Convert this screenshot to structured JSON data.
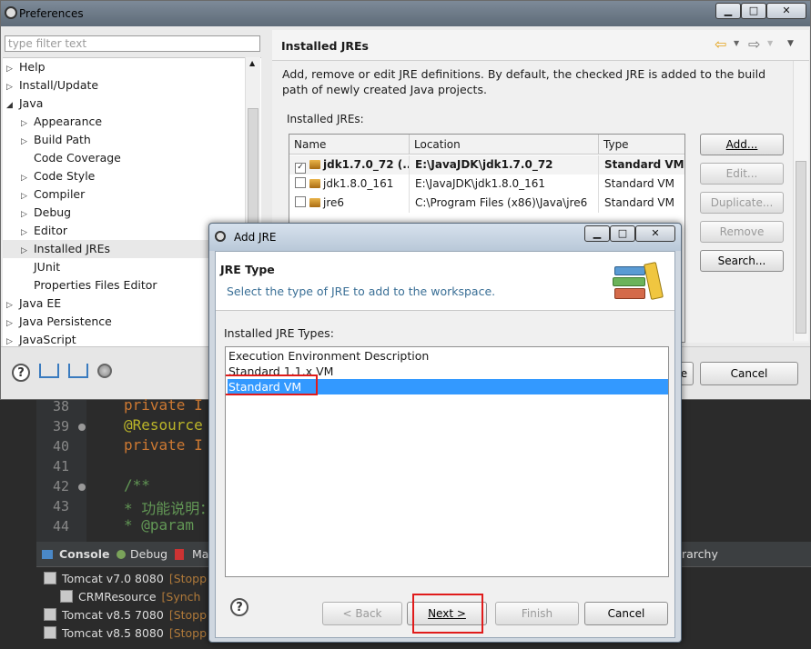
{
  "preferences": {
    "title": "Preferences",
    "filter_placeholder": "type filter text",
    "tree": [
      {
        "label": "Help",
        "expandable": true,
        "depth": 0
      },
      {
        "label": "Install/Update",
        "expandable": true,
        "depth": 0
      },
      {
        "label": "Java",
        "expandable": true,
        "expanded": true,
        "depth": 0
      },
      {
        "label": "Appearance",
        "expandable": true,
        "depth": 1
      },
      {
        "label": "Build Path",
        "expandable": true,
        "depth": 1
      },
      {
        "label": "Code Coverage",
        "expandable": false,
        "depth": 1
      },
      {
        "label": "Code Style",
        "expandable": true,
        "depth": 1
      },
      {
        "label": "Compiler",
        "expandable": true,
        "depth": 1
      },
      {
        "label": "Debug",
        "expandable": true,
        "depth": 1
      },
      {
        "label": "Editor",
        "expandable": true,
        "depth": 1
      },
      {
        "label": "Installed JREs",
        "expandable": true,
        "depth": 1,
        "selected": true
      },
      {
        "label": "JUnit",
        "expandable": false,
        "depth": 1
      },
      {
        "label": "Properties Files Editor",
        "expandable": false,
        "depth": 1
      },
      {
        "label": "Java EE",
        "expandable": true,
        "depth": 0
      },
      {
        "label": "Java Persistence",
        "expandable": true,
        "depth": 0
      },
      {
        "label": "JavaScript",
        "expandable": true,
        "depth": 0
      }
    ],
    "page_title": "Installed JREs",
    "description": "Add, remove or edit JRE definitions. By default, the checked JRE is added to the build path of newly created Java projects.",
    "installed_label": "Installed JREs:",
    "columns": [
      "Name",
      "Location",
      "Type"
    ],
    "jres": [
      {
        "name": "jdk1.7.0_72 (...",
        "location": "E:\\JavaJDK\\jdk1.7.0_72",
        "type": "Standard VM",
        "checked": true,
        "bold": true
      },
      {
        "name": "jdk1.8.0_161",
        "location": "E:\\JavaJDK\\jdk1.8.0_161",
        "type": "Standard VM",
        "checked": false,
        "bold": false
      },
      {
        "name": "jre6",
        "location": "C:\\Program Files (x86)\\Java\\jre6",
        "type": "Standard VM",
        "checked": false,
        "bold": false
      }
    ],
    "buttons": {
      "add": "Add...",
      "edit": "Edit...",
      "duplicate": "Duplicate...",
      "remove": "Remove",
      "search": "Search..."
    },
    "cancel": "Cancel",
    "ok_fragment": "e"
  },
  "editor": {
    "lines": [
      {
        "num": "38",
        "text": "private I",
        "color": "#cc7832"
      },
      {
        "num": "39",
        "text": "@Resource",
        "color": "#bbb529",
        "fold": true
      },
      {
        "num": "40",
        "text": "private I",
        "color": "#cc7832"
      },
      {
        "num": "41",
        "text": "",
        "color": "#a9b7c6"
      },
      {
        "num": "42",
        "text": "/**",
        "color": "#629755",
        "fold": true
      },
      {
        "num": "43",
        "text": " * 功能说明：",
        "color": "#629755"
      },
      {
        "num": "44",
        "text": "  * @param",
        "color": "#629755"
      }
    ]
  },
  "console": {
    "tabs": [
      "Console",
      "Debug",
      "Ma",
      "rarchy"
    ],
    "rows": [
      {
        "name": "Tomcat v7.0 8080",
        "status": "[Stopp"
      },
      {
        "name": "CRMResource",
        "status": "[Synch"
      },
      {
        "name": "Tomcat v8.5 7080",
        "status": "[Stopp"
      },
      {
        "name": "Tomcat v8.5 8080",
        "status": "[Stopp"
      }
    ]
  },
  "dialog": {
    "title": "Add JRE",
    "header_title": "JRE Type",
    "header_desc": "Select the type of JRE to add to the workspace.",
    "list_label": "Installed JRE Types:",
    "types": [
      "Execution Environment Description",
      "Standard 1.1.x VM",
      "Standard VM"
    ],
    "selected_index": 2,
    "buttons": {
      "back": "< Back",
      "next": "Next >",
      "finish": "Finish",
      "cancel": "Cancel"
    }
  }
}
